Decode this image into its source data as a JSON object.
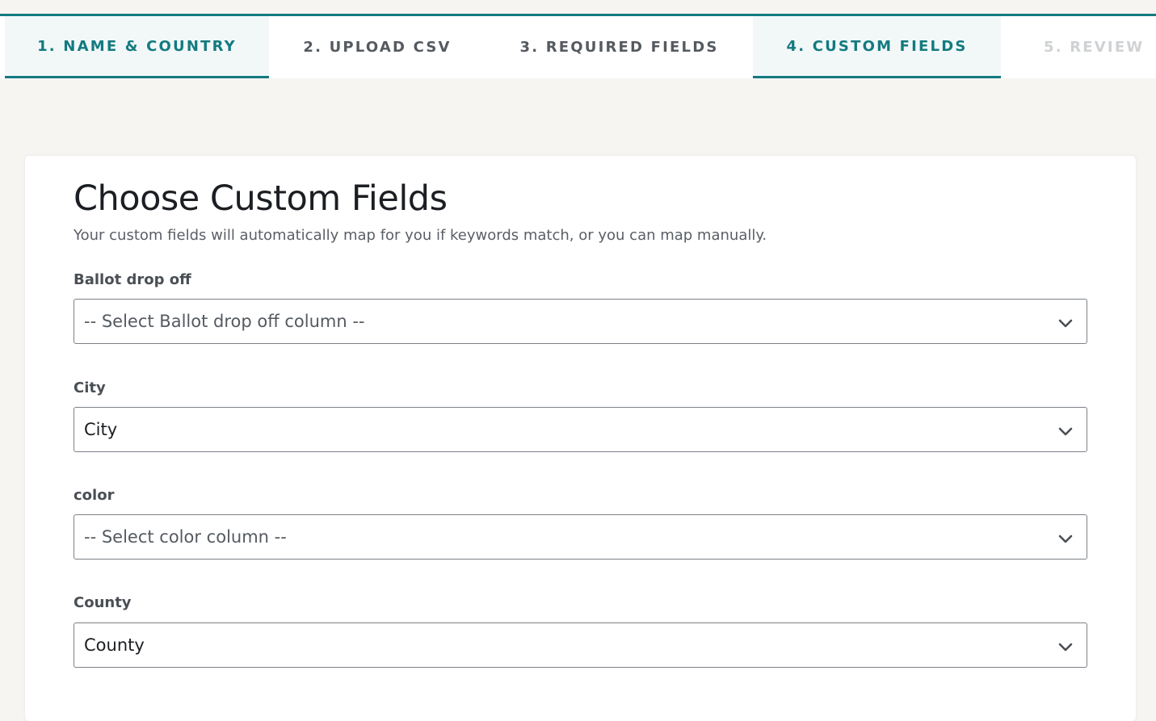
{
  "steps": [
    {
      "label": "1. NAME & COUNTRY",
      "state": "done"
    },
    {
      "label": "2. UPLOAD CSV",
      "state": "done"
    },
    {
      "label": "3. REQUIRED FIELDS",
      "state": "done"
    },
    {
      "label": "4. CUSTOM FIELDS",
      "state": "active"
    },
    {
      "label": "5. REVIEW",
      "state": "future"
    }
  ],
  "card": {
    "title": "Choose Custom Fields",
    "subtitle": "Your custom fields will automatically map for you if keywords match, or you can map manually."
  },
  "fields": [
    {
      "label": "Ballot drop off",
      "value": "-- Select Ballot drop off column --",
      "is_placeholder": true,
      "icon": "chevron-down-icon"
    },
    {
      "label": "City",
      "value": "City",
      "is_placeholder": false,
      "icon": "chevron-down-icon"
    },
    {
      "label": "color",
      "value": "-- Select color column --",
      "is_placeholder": true,
      "icon": "chevron-down-icon"
    },
    {
      "label": "County",
      "value": "County",
      "is_placeholder": false,
      "icon": "chevron-down-icon"
    }
  ],
  "colors": {
    "accent": "#137a80",
    "step_done_bg": "#f2f8f8",
    "page_bg": "#f6f5f2",
    "step_future": "#cfd2d4"
  }
}
